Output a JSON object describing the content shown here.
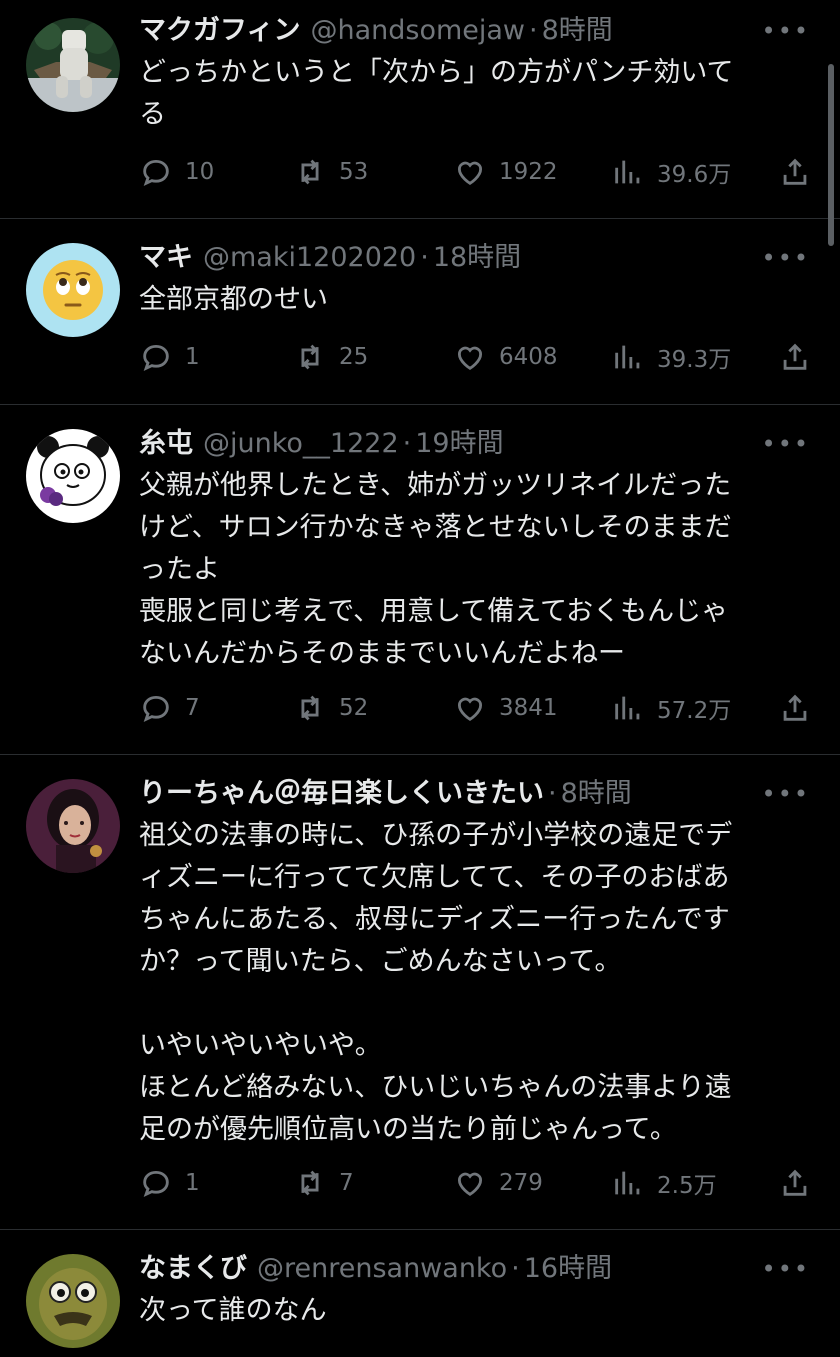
{
  "tweets": [
    {
      "name": "マクガフィン",
      "handle": "@handsomejaw",
      "time": "8時間",
      "text": "どっちかというと「次から」の方がパンチ効いて\nる",
      "stats": {
        "replies": "10",
        "reposts": "53",
        "likes": "1922",
        "views": "39.6万"
      }
    },
    {
      "name": "マキ",
      "handle": "@maki1202020",
      "time": "18時間",
      "text": "全部京都のせい",
      "stats": {
        "replies": "1",
        "reposts": "25",
        "likes": "6408",
        "views": "39.3万"
      }
    },
    {
      "name": "糸屯",
      "handle": "@junko__1222",
      "time": "19時間",
      "text": "父親が他界したとき、姉がガッツリネイルだった\nけど、サロン行かなきゃ落とせないしそのままだ\nったよ\n喪服と同じ考えで、用意して備えておくもんじゃ\nないんだからそのままでいいんだよねー",
      "stats": {
        "replies": "7",
        "reposts": "52",
        "likes": "3841",
        "views": "57.2万"
      }
    },
    {
      "name": "りーちゃん＠毎日楽しくいきたい",
      "handle": "",
      "time": "8時間",
      "text": "祖父の法事の時に、ひ孫の子が小学校の遠足でデ\nィズニーに行ってて欠席してて、その子のおばあ\nちゃんにあたる、叔母にディズニー行ったんです\nか？って聞いたら、ごめんなさいって。\n\nいやいやいやいや。\nほとんど絡みない、ひいじいちゃんの法事より遠\n足のが優先順位高いの当たり前じゃんって。",
      "stats": {
        "replies": "1",
        "reposts": "7",
        "likes": "279",
        "views": "2.5万"
      }
    },
    {
      "name": "なまくび",
      "handle": "@renrensanwanko",
      "time": "16時間",
      "text": "次って誰のなん",
      "stats": {
        "replies": "",
        "reposts": "",
        "likes": "",
        "views": ""
      }
    }
  ],
  "more_label": "•••",
  "separator": "·",
  "icons": [
    "reply-icon",
    "repost-icon",
    "like-icon",
    "views-icon",
    "share-icon"
  ],
  "colors": {
    "background": "#000000",
    "text": "#e7e9ea",
    "muted": "#71767b",
    "divider": "#2a2d30"
  }
}
